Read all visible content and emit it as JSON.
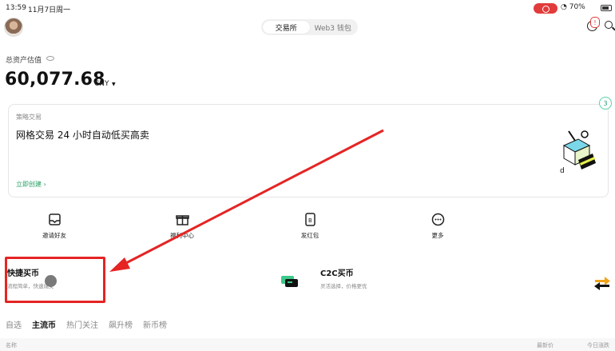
{
  "status": {
    "time": "13:59",
    "date": "11月7日周一",
    "battery": "70%"
  },
  "header": {
    "tabs": [
      {
        "label": "交易所"
      },
      {
        "label": "Web3 钱包"
      }
    ],
    "msg_badge": "!"
  },
  "assets": {
    "label": "总资产估值",
    "value": "60,077.68",
    "unit": "CNY"
  },
  "promo": {
    "tag": "策略交易",
    "title": "网格交易 24 小时自动低买高卖",
    "link": "立即创建",
    "page": "3"
  },
  "quick_actions": [
    {
      "label": "邀请好友",
      "icon": "inbox-icon"
    },
    {
      "label": "福利中心",
      "icon": "gift-icon"
    },
    {
      "label": "发红包",
      "icon": "red-packet-icon"
    },
    {
      "label": "更多",
      "icon": "more-icon"
    }
  ],
  "buy": {
    "quick": {
      "title": "快捷买币",
      "sub": "流程简单，快速成交"
    },
    "c2c": {
      "title": "C2C买币",
      "sub": "灵活选择，价格更优"
    }
  },
  "market": {
    "tabs": [
      {
        "label": "自选"
      },
      {
        "label": "主流币"
      },
      {
        "label": "热门关注"
      },
      {
        "label": "飙升榜"
      },
      {
        "label": "新币榜"
      }
    ],
    "columns": {
      "name": "名称",
      "price": "最新价",
      "change": "今日涨跌"
    }
  },
  "colors": {
    "accent": "#27a063",
    "highlight": "#e52424"
  }
}
